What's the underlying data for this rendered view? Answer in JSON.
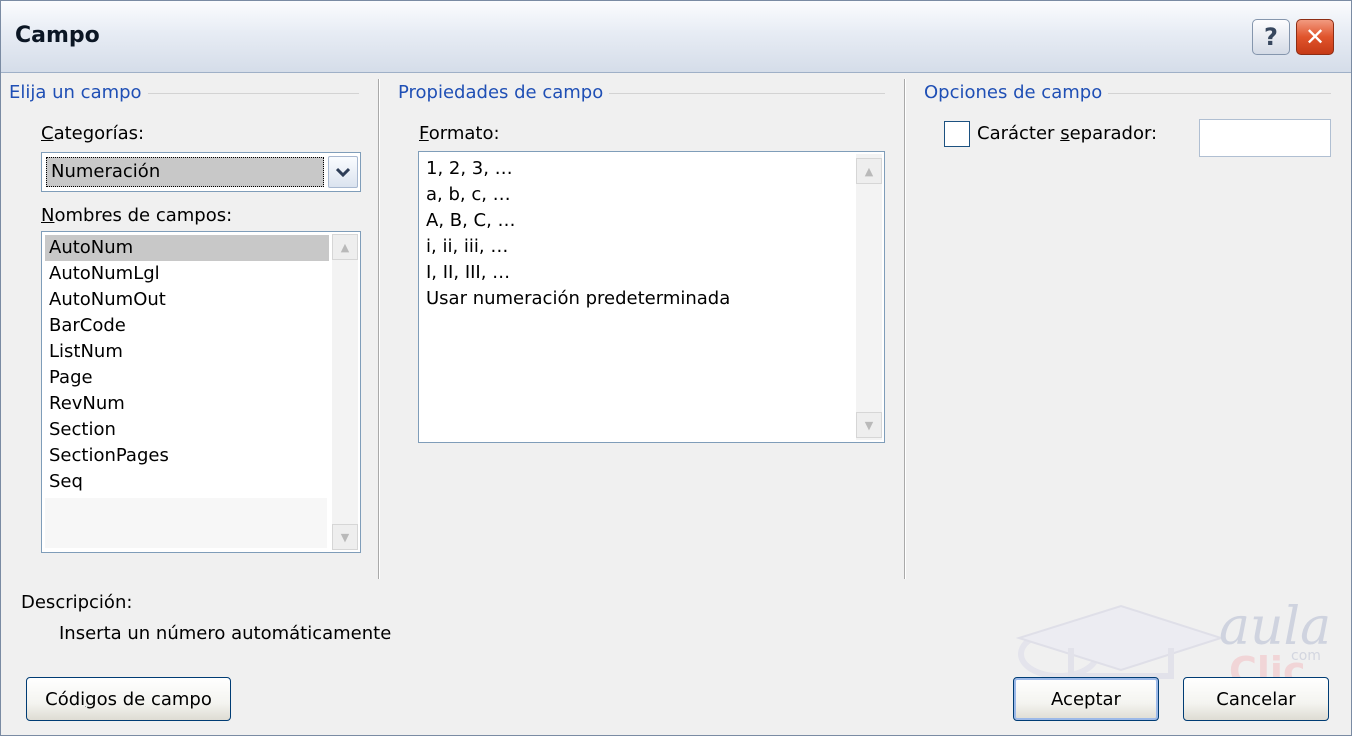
{
  "window": {
    "title": "Campo",
    "help_glyph": "?",
    "close_glyph": "✕"
  },
  "left_group": {
    "title": "Elija un campo",
    "categories_label": "Categorías:",
    "categories_selected": "Numeración",
    "field_names_label": "Nombres de campos:",
    "field_names": [
      "AutoNum",
      "AutoNumLgl",
      "AutoNumOut",
      "BarCode",
      "ListNum",
      "Page",
      "RevNum",
      "Section",
      "SectionPages",
      "Seq"
    ],
    "selected_field": "AutoNum"
  },
  "middle_group": {
    "title": "Propiedades de campo",
    "format_label": "Formato:",
    "formats": [
      "1, 2, 3, …",
      "a, b, c, …",
      "A, B, C, …",
      "i, ii, iii, …",
      "I, II, III, …",
      "Usar numeración predeterminada"
    ]
  },
  "right_group": {
    "title": "Opciones de campo",
    "separator_label": "Carácter separador:",
    "separator_checked": false,
    "separator_value": ""
  },
  "description": {
    "label": "Descripción:",
    "text": "Inserta un número automáticamente"
  },
  "buttons": {
    "field_codes": "Códigos de campo",
    "ok": "Aceptar",
    "cancel": "Cancelar"
  },
  "watermark": {
    "brand_top": "aula",
    "brand_mid": "com",
    "brand_bottom": "Clic"
  },
  "colors": {
    "group_title": "#1f4fb5",
    "selection": "#c8c8c8",
    "close_button": "#d9502a",
    "button_border": "#003c74"
  }
}
